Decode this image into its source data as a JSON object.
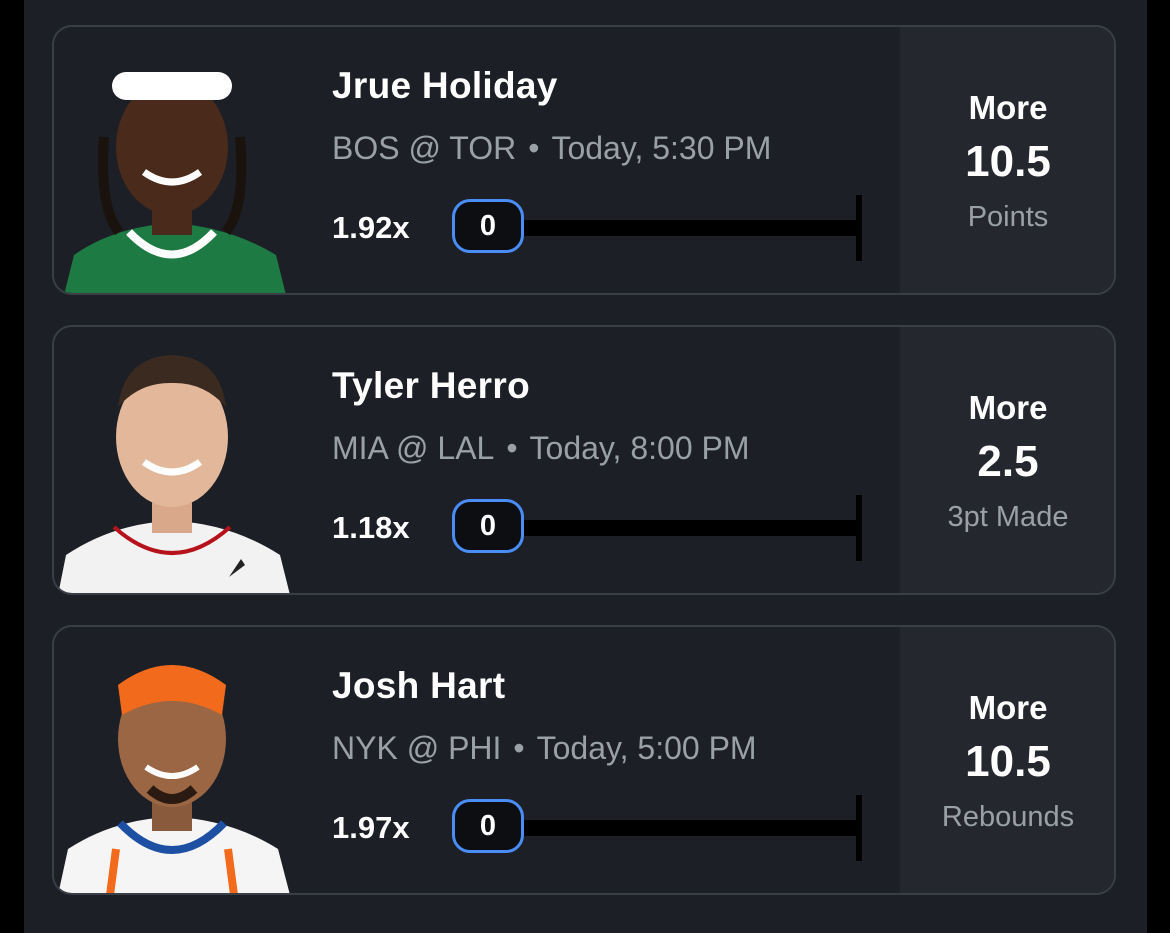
{
  "picks": [
    {
      "player": "Jrue Holiday",
      "away": "BOS",
      "home": "TOR",
      "at": "@",
      "separator": "•",
      "time": "Today, 5:30 PM",
      "multiplier": "1.92x",
      "progress_value": "0",
      "progress_fraction": 0,
      "direction": "More",
      "line": "10.5",
      "stat": "Points",
      "jersey_color": "#1d7a43",
      "jersey_trim": "#ffffff"
    },
    {
      "player": "Tyler Herro",
      "away": "MIA",
      "home": "LAL",
      "at": "@",
      "separator": "•",
      "time": "Today, 8:00 PM",
      "multiplier": "1.18x",
      "progress_value": "0",
      "progress_fraction": 0,
      "direction": "More",
      "line": "2.5",
      "stat": "3pt Made",
      "jersey_color": "#f2f2f2",
      "jersey_trim": "#b5121b"
    },
    {
      "player": "Josh Hart",
      "away": "NYK",
      "home": "PHI",
      "at": "@",
      "separator": "•",
      "time": "Today, 5:00 PM",
      "multiplier": "1.97x",
      "progress_value": "0",
      "progress_fraction": 0,
      "direction": "More",
      "line": "10.5",
      "stat": "Rebounds",
      "jersey_color": "#f5f5f5",
      "jersey_trim": "#f26b1d"
    }
  ],
  "colors": {
    "background": "#1c1f25",
    "card_border": "#3a3f47",
    "side_panel": "#24272e",
    "accent": "#4a8df7",
    "muted_text": "#9aa0a8"
  }
}
